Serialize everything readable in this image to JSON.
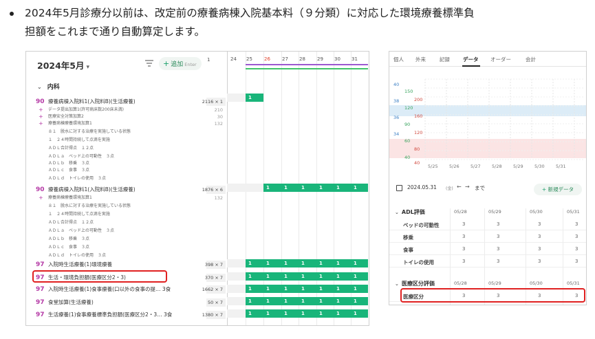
{
  "bullet": {
    "line1": "2024年5月診療分以前は、改定前の療養病棟入院基本料（９分類）に対応した環境療養標準負",
    "line2": "担額をこれまで通り自動算定します。"
  },
  "left": {
    "month": "2024年5月",
    "add_label": "追加",
    "enter_hint": "Enter",
    "col_one": "1",
    "section": "内科",
    "rows": [
      {
        "code": "90",
        "name": "療養病棟入院料1(入院料B)(生活療養)",
        "qty": "2116 × 1"
      },
      {
        "name": "データ提出加算1(許可病床数200床未満)",
        "qty": "210"
      },
      {
        "name": "医療安全対策加算2",
        "qty": "30"
      },
      {
        "name": "療養病棟療養環境加算1",
        "qty": "132"
      },
      {
        "name": "８１　脱水に対する治療を実施している状態"
      },
      {
        "name": "１　２４時間持続して点滴を実施"
      },
      {
        "name": "ＡＤＬ合計得点　１２点"
      },
      {
        "name": "ＡＤＬａ　ベッド上の可動性　３点"
      },
      {
        "name": "ＡＤＬｂ　移乗　３点"
      },
      {
        "name": "ＡＤＬｃ　食事　３点"
      },
      {
        "name": "ＡＤＬｄ　トイレの使用　３点"
      },
      {
        "code": "90",
        "name": "療養病棟入院料1(入院料B)(生活療養)",
        "qty": "1876 × 6"
      },
      {
        "name": "療養病棟療養環境加算1",
        "qty": "132"
      },
      {
        "name": "８１　脱水に対する治療を実施している状態"
      },
      {
        "name": "１　２４時間持続して点滴を実施"
      },
      {
        "name": "ＡＤＬ合計得点　１２点"
      },
      {
        "name": "ＡＤＬａ　ベッド上の可動性　３点"
      },
      {
        "name": "ＡＤＬｂ　移乗　３点"
      },
      {
        "name": "ＡＤＬｃ　食事　３点"
      },
      {
        "name": "ＡＤＬｄ　トイレの使用　３点"
      },
      {
        "code": "97",
        "name": "入院時生活療養(1)環境療養",
        "qty": "398 × 7"
      },
      {
        "code": "97",
        "name": "生活・環境負担額(医療区分2・3)",
        "qty": "370 × 7"
      },
      {
        "code": "97",
        "name": "入院時生活療養(1)食事療養(口以外の食事の提… 3食",
        "qty": "1662 × 7"
      },
      {
        "code": "97",
        "name": "食堂加算(生活療養)",
        "qty": "50 × 7"
      },
      {
        "code": "97",
        "name": "生活療養(1)食事療養標準負担額(医療区分2・3… 3食",
        "qty": "1380 × 7"
      }
    ],
    "gantt_days": [
      "24",
      "25",
      "26",
      "27",
      "28",
      "29",
      "30",
      "31"
    ],
    "gantt_cell": "1"
  },
  "right": {
    "tabs": [
      "個人",
      "外来",
      "記録",
      "データ",
      "オーダー",
      "会計"
    ],
    "chart": {
      "left_axis_blue": [
        "40",
        "38",
        "36",
        "34"
      ],
      "left_axis_green": [
        "150",
        "120",
        "90",
        "60",
        "40"
      ],
      "left_axis_red": [
        "200",
        "160",
        "120",
        "80",
        "40"
      ],
      "dates": [
        "5/25",
        "5/26",
        "5/27",
        "5/28",
        "5/29",
        "5/30",
        "5/31"
      ]
    },
    "date": "2024.05.31",
    "weekday": "(金)",
    "until": "まで",
    "new_data": "新規データ",
    "adl_title": "ADL評価",
    "cols": [
      "05/28",
      "05/29",
      "05/30",
      "05/31"
    ],
    "adl_rows": [
      {
        "label": "ベッドの可動性",
        "vals": [
          "3",
          "3",
          "3",
          "3"
        ]
      },
      {
        "label": "移乗",
        "vals": [
          "3",
          "3",
          "3",
          "3"
        ]
      },
      {
        "label": "食事",
        "vals": [
          "3",
          "3",
          "3",
          "3"
        ]
      },
      {
        "label": "トイレの使用",
        "vals": [
          "3",
          "3",
          "3",
          "3"
        ]
      }
    ],
    "med_title": "医療区分評価",
    "med_rows": [
      {
        "label": "医療区分",
        "vals": [
          "3",
          "3",
          "3",
          "3"
        ]
      }
    ]
  }
}
